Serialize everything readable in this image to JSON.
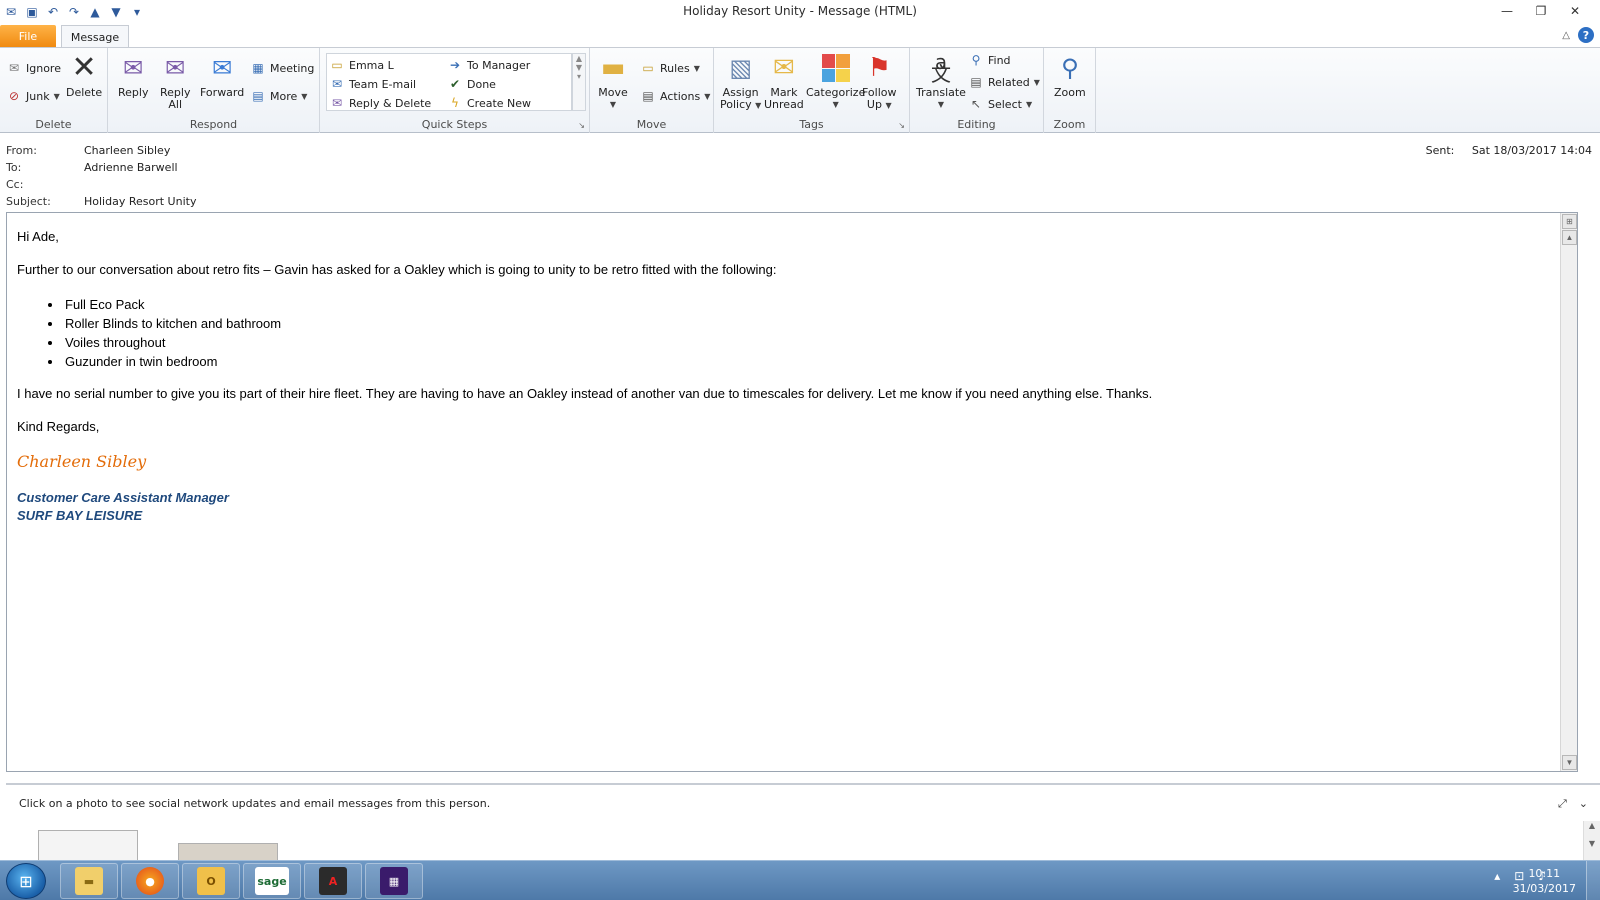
{
  "window": {
    "title": "Holiday Resort Unity  -  Message (HTML)"
  },
  "tabs": {
    "file": "File",
    "message": "Message"
  },
  "ribbon": {
    "delete_group": {
      "label": "Delete",
      "ignore": "Ignore",
      "junk": "Junk",
      "delete": "Delete"
    },
    "respond_group": {
      "label": "Respond",
      "reply": "Reply",
      "reply_all_1": "Reply",
      "reply_all_2": "All",
      "forward": "Forward",
      "meeting": "Meeting",
      "more": "More"
    },
    "quicksteps_group": {
      "label": "Quick Steps",
      "items": [
        "Emma L",
        "Team E-mail",
        "Reply & Delete",
        "To Manager",
        "Done",
        "Create New"
      ]
    },
    "move_group": {
      "label": "Move",
      "move": "Move",
      "rules": "Rules",
      "actions": "Actions"
    },
    "tags_group": {
      "label": "Tags",
      "assign_policy_1": "Assign",
      "assign_policy_2": "Policy",
      "mark_unread_1": "Mark",
      "mark_unread_2": "Unread",
      "categorize": "Categorize",
      "follow_up_1": "Follow",
      "follow_up_2": "Up"
    },
    "editing_group": {
      "label": "Editing",
      "translate": "Translate",
      "find": "Find",
      "related": "Related",
      "select": "Select"
    },
    "zoom_group": {
      "label": "Zoom",
      "zoom": "Zoom"
    }
  },
  "header": {
    "from_label": "From:",
    "from_value": "Charleen Sibley",
    "to_label": "To:",
    "to_value": "Adrienne Barwell",
    "cc_label": "Cc:",
    "cc_value": "",
    "subject_label": "Subject:",
    "subject_value": "Holiday Resort Unity",
    "sent_label": "Sent:",
    "sent_value": "Sat 18/03/2017 14:04"
  },
  "body": {
    "greeting": "Hi Ade,",
    "intro": "Further to our conversation about retro fits – Gavin has asked for a Oakley which is going to unity to be retro fitted with the following:",
    "bullets": [
      "Full Eco Pack",
      "Roller Blinds to kitchen and bathroom",
      "Voiles throughout",
      "Guzunder in twin bedroom"
    ],
    "paragraph": "I have no serial number to give you its part of their hire fleet.  They are having to have an Oakley instead of another van due to timescales for delivery.  Let me know if you need anything else. Thanks.",
    "closing": "Kind Regards,",
    "sig_name": "Charleen Sibley",
    "sig_title": "Customer Care Assistant Manager",
    "sig_company": "SURF BAY LEISURE"
  },
  "people_pane": {
    "text": "Click on a photo to see social network updates and email messages from this person."
  },
  "taskbar": {
    "time": "10:11",
    "date": "31/03/2017",
    "sage_label": "sage"
  }
}
